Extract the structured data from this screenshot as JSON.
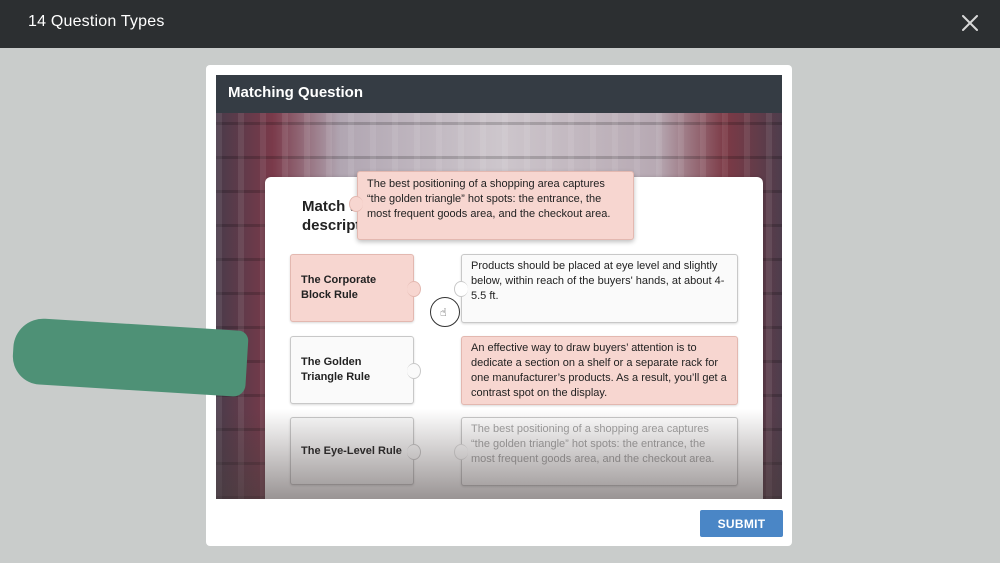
{
  "window": {
    "title": "14 Question Types",
    "close_icon": "close-icon"
  },
  "question": {
    "header": "Matching Question",
    "instruction": "Match the key merchandising rules with their description."
  },
  "terms": [
    {
      "label": "The Corporate Block Rule"
    },
    {
      "label": "The Golden Triangle Rule"
    },
    {
      "label": "The Eye-Level Rule"
    }
  ],
  "definitions": [
    {
      "text": "Products should be placed at eye level and slightly below, within reach of the buyers' hands, at about 4-5.5 ft."
    },
    {
      "text": "An effective way to draw buyers’ attention is to dedicate a section on a shelf or a separate rack for one manufacturer’s products. As a result, you’ll get a contrast spot on the display."
    },
    {
      "text": "The best positioning of a shopping area captures “the golden triangle” hot spots: the entrance, the most frequent goods area, and the checkout area."
    }
  ],
  "dragged_card": {
    "text": "The best positioning of a shopping area captures “the golden triangle” hot spots: the entrance, the most frequent goods area, and the checkout area."
  },
  "submit_label": "SUBMIT",
  "colors": {
    "topbar": "#2c2f31",
    "header": "#353c44",
    "matched_fill": "#f7d6d0",
    "submit": "#4a86c6",
    "annotation_stroke": "#4e9176"
  }
}
